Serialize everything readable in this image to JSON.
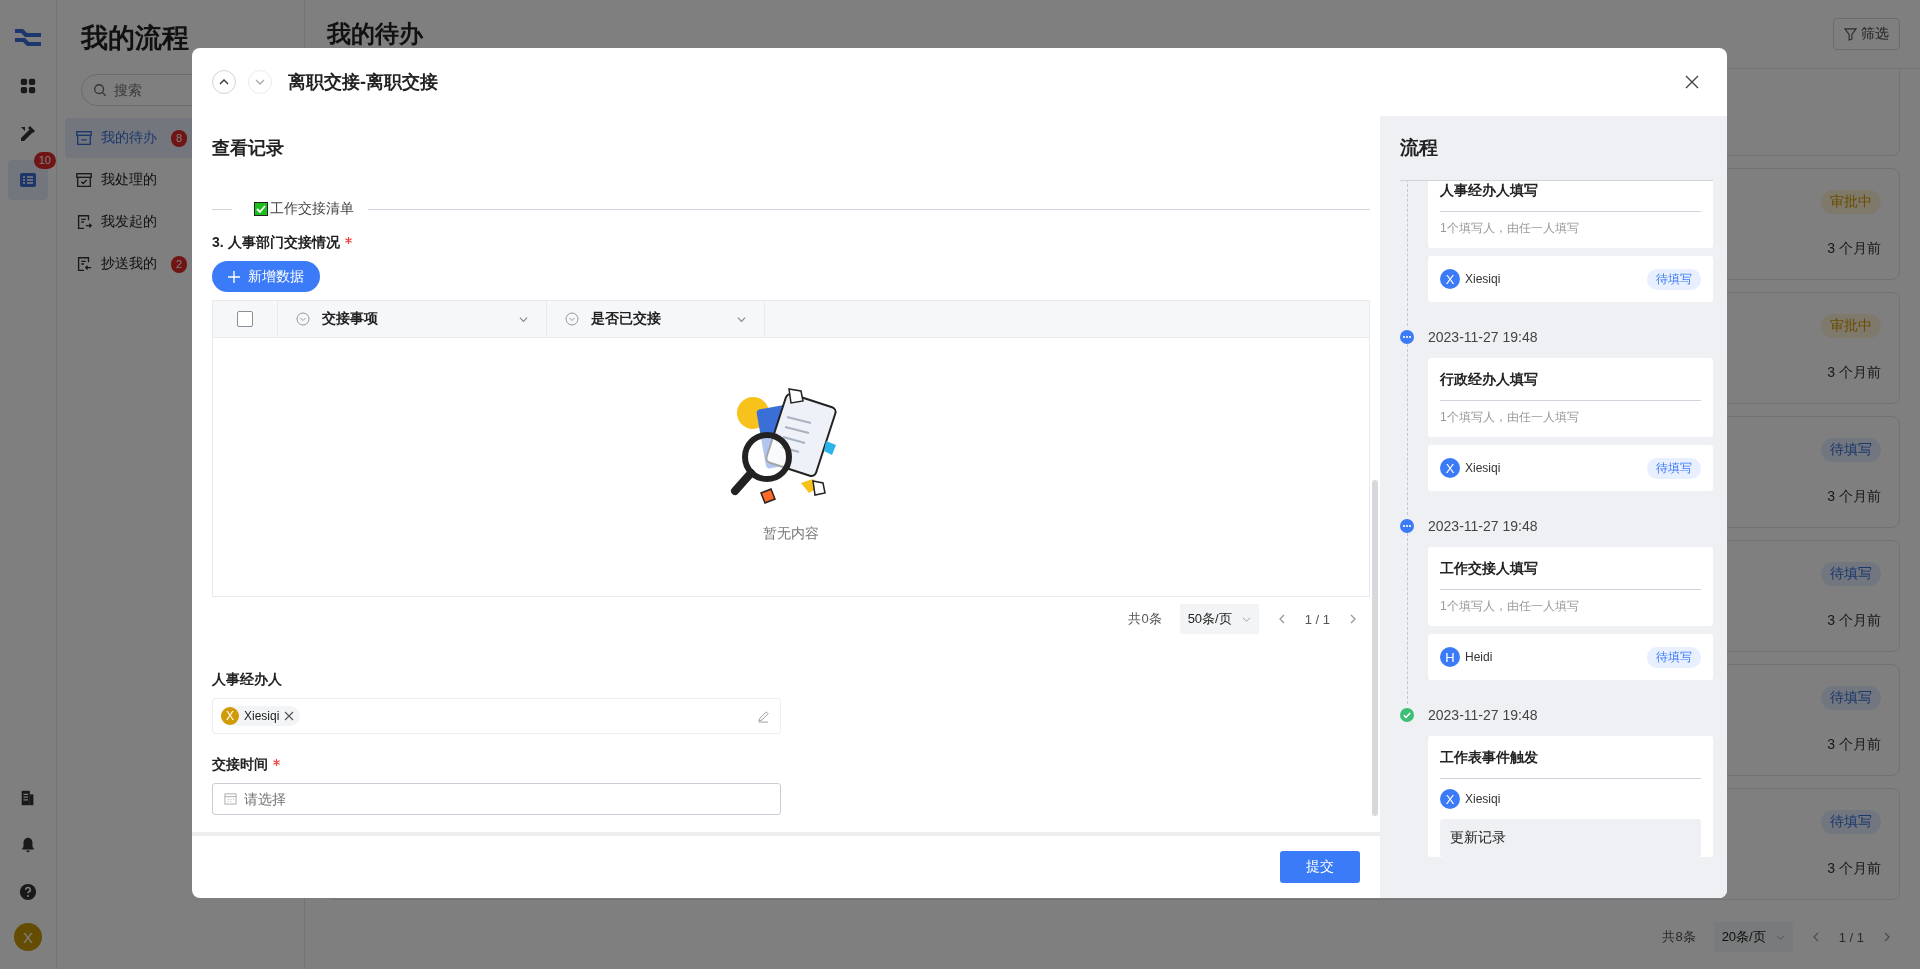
{
  "rail": {
    "items": [
      {
        "kind": "grid",
        "selected": false
      },
      {
        "kind": "tools",
        "selected": false
      },
      {
        "kind": "list",
        "selected": true,
        "badge": "10"
      }
    ],
    "bottom": [
      {
        "kind": "book"
      },
      {
        "kind": "bell"
      },
      {
        "kind": "help"
      }
    ],
    "avatar": "X"
  },
  "sidebar": {
    "title": "我的流程",
    "search_placeholder": "搜索",
    "items": [
      {
        "label": "我的待办",
        "selected": true,
        "badge": "8",
        "kind": "inbox"
      },
      {
        "label": "我处理的",
        "selected": false,
        "kind": "done"
      },
      {
        "label": "我发起的",
        "selected": false,
        "kind": "sent"
      },
      {
        "label": "抄送我的",
        "selected": false,
        "badge": "2",
        "kind": "cc"
      }
    ]
  },
  "main": {
    "title": "我的待办",
    "filter_button": "筛选",
    "cards": [
      {
        "status": "审批中",
        "kind": "approving",
        "time": "3 个月前"
      },
      {
        "status": "审批中",
        "kind": "approving",
        "time": "3 个月前"
      },
      {
        "status": "待填写",
        "kind": "pending",
        "time": "3 个月前"
      },
      {
        "status": "待填写",
        "kind": "pending",
        "time": "3 个月前"
      },
      {
        "status": "待填写",
        "kind": "pending",
        "time": "3 个月前"
      },
      {
        "status": "待填写",
        "kind": "pending",
        "time": "3 个月前"
      }
    ],
    "pagination": {
      "total": "共8条",
      "page_size": "20条/页",
      "page": "1 / 1"
    }
  },
  "modal": {
    "title": "离职交接-离职交接",
    "section_title": "查看记录",
    "group_divider": "工作交接清单",
    "subtable": {
      "label": "3. 人事部门交接情况",
      "required": true,
      "add_button": "新增数据",
      "columns": [
        "交接事项",
        "是否已交接"
      ],
      "select_all_checked": false,
      "empty_text": "暂无内容",
      "pagination": {
        "total": "共0条",
        "page_size": "50条/页",
        "page": "1 / 1"
      }
    },
    "fields": [
      {
        "kind": "member",
        "label": "人事经办人",
        "required": false,
        "members": [
          {
            "initial": "X",
            "name": "Xiesiqi"
          }
        ]
      },
      {
        "kind": "date",
        "label": "交接时间",
        "required": true,
        "placeholder": "请选择"
      }
    ],
    "submit_button": "提交"
  },
  "flow": {
    "title": "流程",
    "steps": [
      {
        "kind": "fill",
        "title": "人事经办人填写",
        "note": "1个填写人，由任一人填写",
        "assignees": [
          {
            "initial": "X",
            "name": "Xiesiqi",
            "tag": "待填写"
          }
        ]
      },
      {
        "time": "2023-11-27 19:48",
        "completed": false,
        "kind": "fill",
        "title": "行政经办人填写",
        "note": "1个填写人，由任一人填写",
        "assignees": [
          {
            "initial": "X",
            "name": "Xiesiqi",
            "tag": "待填写"
          }
        ]
      },
      {
        "time": "2023-11-27 19:48",
        "completed": false,
        "kind": "fill",
        "title": "工作交接人填写",
        "note": "1个填写人，由任一人填写",
        "assignees": [
          {
            "initial": "H",
            "name": "Heidi",
            "tag": "待填写"
          }
        ]
      },
      {
        "time": "2023-11-27 19:48",
        "completed": true,
        "kind": "trigger",
        "title": "工作表事件触发",
        "assignees": [
          {
            "initial": "X",
            "name": "Xiesiqi"
          }
        ],
        "record": "更新记录"
      }
    ]
  }
}
